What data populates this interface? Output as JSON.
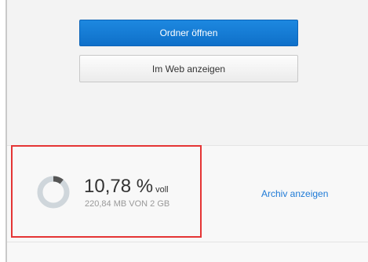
{
  "actions": {
    "open_folder_label": "Ordner öffnen",
    "view_web_label": "Im Web anzeigen"
  },
  "storage": {
    "percent_label": "10,78 %",
    "percent_suffix": "voll",
    "usage_detail": "220,84 MB VON 2 GB",
    "used_fraction": 0.1078,
    "icon": "usage-ring-icon"
  },
  "archive": {
    "link_label": "Archiv anzeigen"
  },
  "colors": {
    "primary_button": "#1a80d9",
    "link": "#1e7ad6",
    "highlight_border": "#e53535",
    "ring_used": "#555555",
    "ring_free": "#cfd6db"
  }
}
